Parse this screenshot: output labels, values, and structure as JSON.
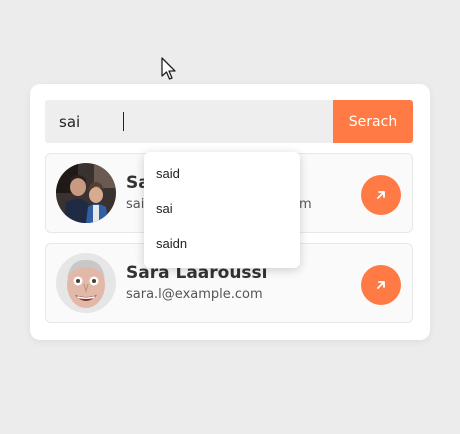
{
  "search": {
    "value": "sai",
    "button_label": "Serach"
  },
  "results": [
    {
      "name": "Sa",
      "email": "sai",
      "email_tail": "m",
      "avatar": "group-photo-avatar"
    },
    {
      "name": "Sara Laaroussi",
      "email": "sara.l@example.com",
      "avatar": "face-photo-avatar"
    }
  ],
  "suggestions": [
    "said",
    "sai",
    "saidn"
  ],
  "colors": {
    "accent": "#ff7a45",
    "input_bg": "#eeeeee",
    "page_bg": "#ececec"
  },
  "icons": {
    "open": "arrow-up-right-icon",
    "pointer": "mouse-cursor-icon"
  }
}
